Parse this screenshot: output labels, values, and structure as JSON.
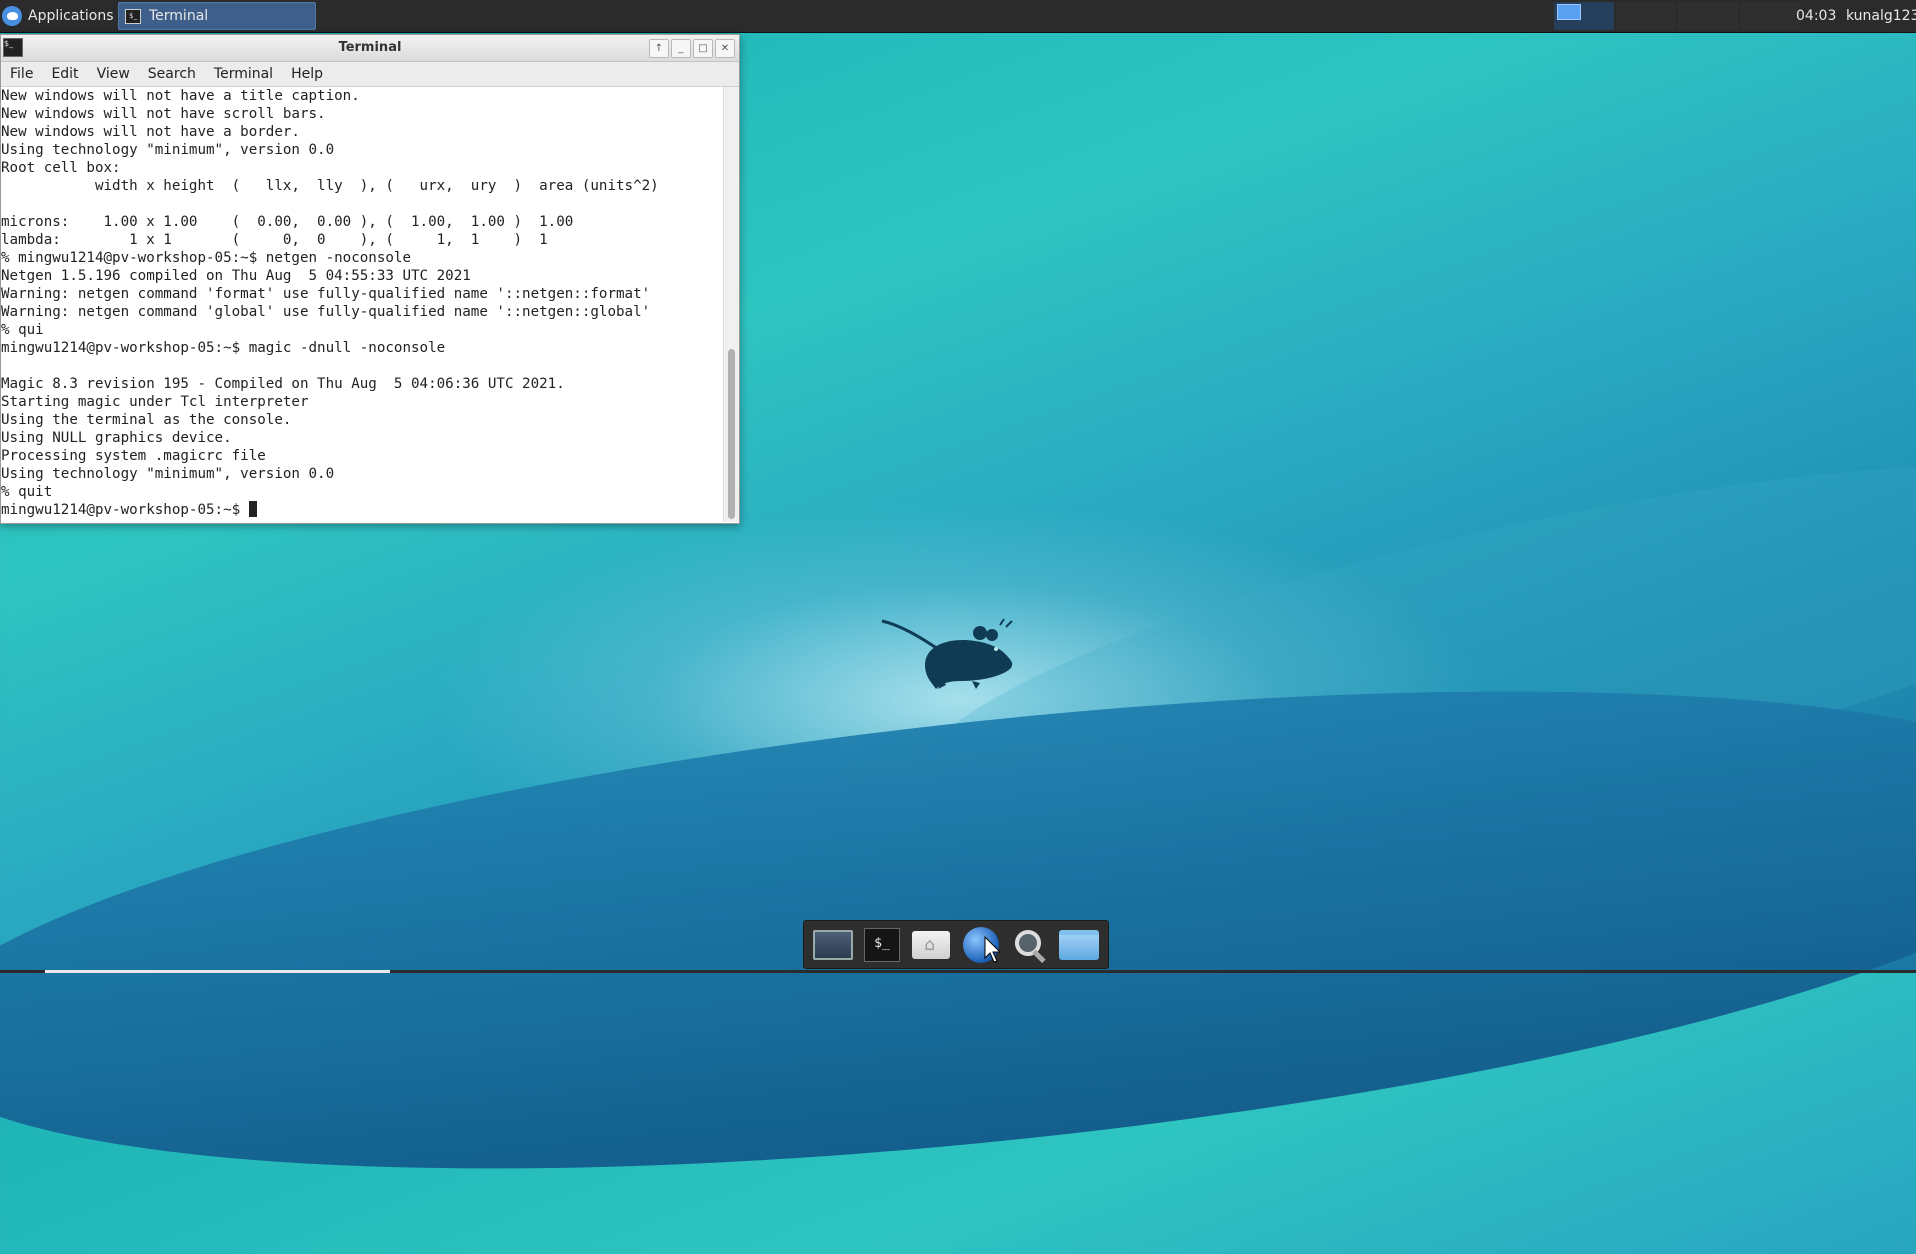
{
  "panel": {
    "applications_label": "Applications",
    "task_terminal_label": "Terminal",
    "clock": "04:03",
    "user": "kunalg123"
  },
  "terminal": {
    "title": "Terminal",
    "menu": [
      "File",
      "Edit",
      "View",
      "Search",
      "Terminal",
      "Help"
    ],
    "lines": [
      "New windows will not have a title caption.",
      "New windows will not have scroll bars.",
      "New windows will not have a border.",
      "Using technology \"minimum\", version 0.0",
      "Root cell box:",
      "           width x height  (   llx,  lly  ), (   urx,  ury  )  area (units^2)",
      "",
      "microns:    1.00 x 1.00    (  0.00,  0.00 ), (  1.00,  1.00 )  1.00",
      "lambda:        1 x 1       (     0,  0    ), (     1,  1    )  1",
      "% mingwu1214@pv-workshop-05:~$ netgen -noconsole",
      "Netgen 1.5.196 compiled on Thu Aug  5 04:55:33 UTC 2021",
      "Warning: netgen command 'format' use fully-qualified name '::netgen::format'",
      "Warning: netgen command 'global' use fully-qualified name '::netgen::global'",
      "% qui",
      "mingwu1214@pv-workshop-05:~$ magic -dnull -noconsole",
      "",
      "Magic 8.3 revision 195 - Compiled on Thu Aug  5 04:06:36 UTC 2021.",
      "Starting magic under Tcl interpreter",
      "Using the terminal as the console.",
      "Using NULL graphics device.",
      "Processing system .magicrc file",
      "Using technology \"minimum\", version 0.0",
      "% quit"
    ],
    "prompt": "mingwu1214@pv-workshop-05:~$ "
  },
  "dock": {
    "items": [
      "desktop-icon",
      "terminal-icon",
      "home-folder-icon",
      "web-browser-icon",
      "search-icon",
      "folder-icon"
    ],
    "terminal_glyph": "$_"
  }
}
